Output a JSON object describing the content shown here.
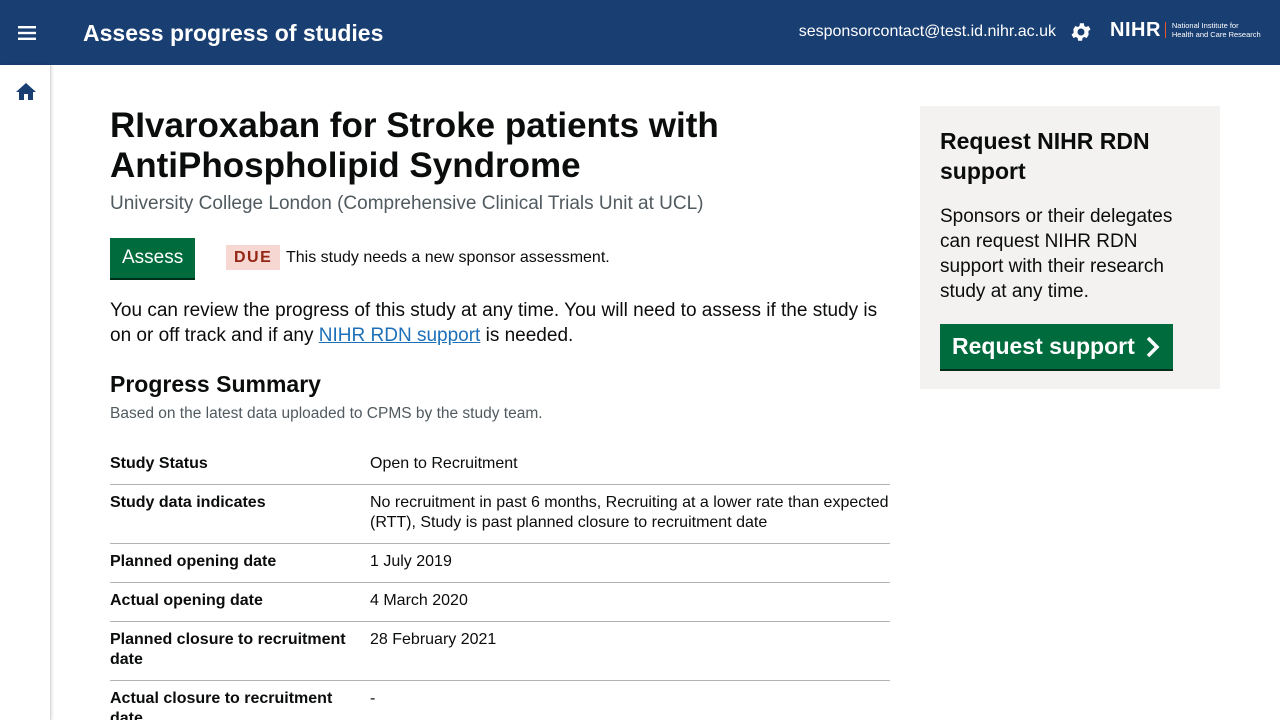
{
  "header": {
    "title": "Assess progress of studies",
    "user_email": "sesponsorcontact@test.id.nihr.ac.uk",
    "logo_mark": "NIHR",
    "logo_line1": "National Institute for",
    "logo_line2": "Health and Care Research"
  },
  "study": {
    "title": "RIvaroxaban for Stroke patients with AntiPhospholipid Syndrome",
    "sponsor_org": "University College London (Comprehensive Clinical Trials Unit at UCL)",
    "assess_label": "Assess",
    "due_tag": "DUE",
    "due_text": "This study needs a new sponsor assessment.",
    "intro_before": "You can review the progress of this study at any time. You will need to assess if the study is on or off track and if any ",
    "intro_link": "NIHR RDN support",
    "intro_after": " is needed."
  },
  "summary": {
    "title": "Progress Summary",
    "subtitle": "Based on the latest data uploaded to CPMS by the study team.",
    "rows": [
      {
        "key": "Study Status",
        "value": "Open to Recruitment"
      },
      {
        "key": "Study data indicates",
        "value": "No recruitment in past 6 months, Recruiting at a lower rate than expected (RTT), Study is past planned closure to recruitment date"
      },
      {
        "key": "Planned opening date",
        "value": "1 July 2019"
      },
      {
        "key": "Actual opening date",
        "value": "4 March 2020"
      },
      {
        "key": "Planned closure to recruitment date",
        "value": "28 February 2021"
      },
      {
        "key": "Actual closure to recruitment date",
        "value": "-"
      }
    ]
  },
  "aside": {
    "title": "Request NIHR RDN support",
    "text": "Sponsors or their delegates can request NIHR RDN support with their research study at any time.",
    "button_label": "Request support"
  },
  "colors": {
    "header_bg": "#193e72",
    "primary_green": "#006c3d",
    "due_bg": "#f6d7d2",
    "due_text": "#942514",
    "link": "#1d70b8"
  }
}
